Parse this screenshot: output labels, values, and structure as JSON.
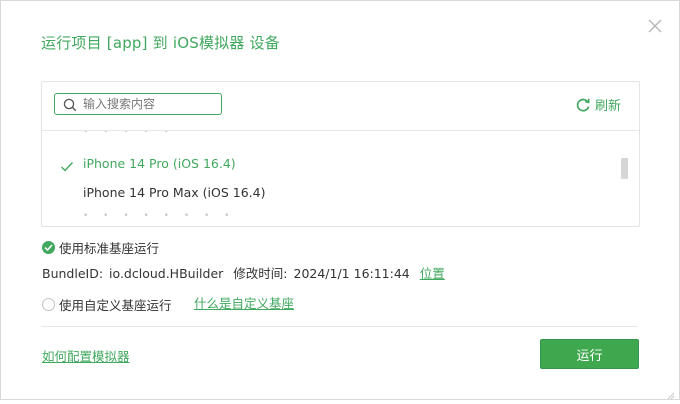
{
  "dialog": {
    "title": "运行项目 [app] 到 iOS模拟器 设备",
    "close_icon": "close-icon"
  },
  "device_panel": {
    "search": {
      "placeholder": "输入搜索内容",
      "value": ""
    },
    "refresh_label": "刷新",
    "devices": [
      {
        "label": "iPhone 14 Pro (iOS 16.4)",
        "selected": true
      },
      {
        "label": "iPhone 14 Pro Max (iOS 16.4)",
        "selected": false
      }
    ],
    "partial_items": [
      "• • • • •",
      "• • • • • • • •"
    ]
  },
  "standard_base": {
    "label": "使用标准基座运行",
    "selected": true,
    "bundle_id_label": "BundleID:",
    "bundle_id": "io.dcloud.HBuilder",
    "modified_label": "修改时间:",
    "modified_time": "2024/1/1 16:11:44",
    "location_link": "位置"
  },
  "custom_base": {
    "label": "使用自定义基座运行",
    "selected": false,
    "help_link": "什么是自定义基座"
  },
  "footer": {
    "config_link": "如何配置模拟器",
    "run_button": "运行"
  },
  "colors": {
    "accent": "#41a85f",
    "button": "#3fa84f",
    "text": "#333333",
    "border": "#e3e3e3"
  }
}
